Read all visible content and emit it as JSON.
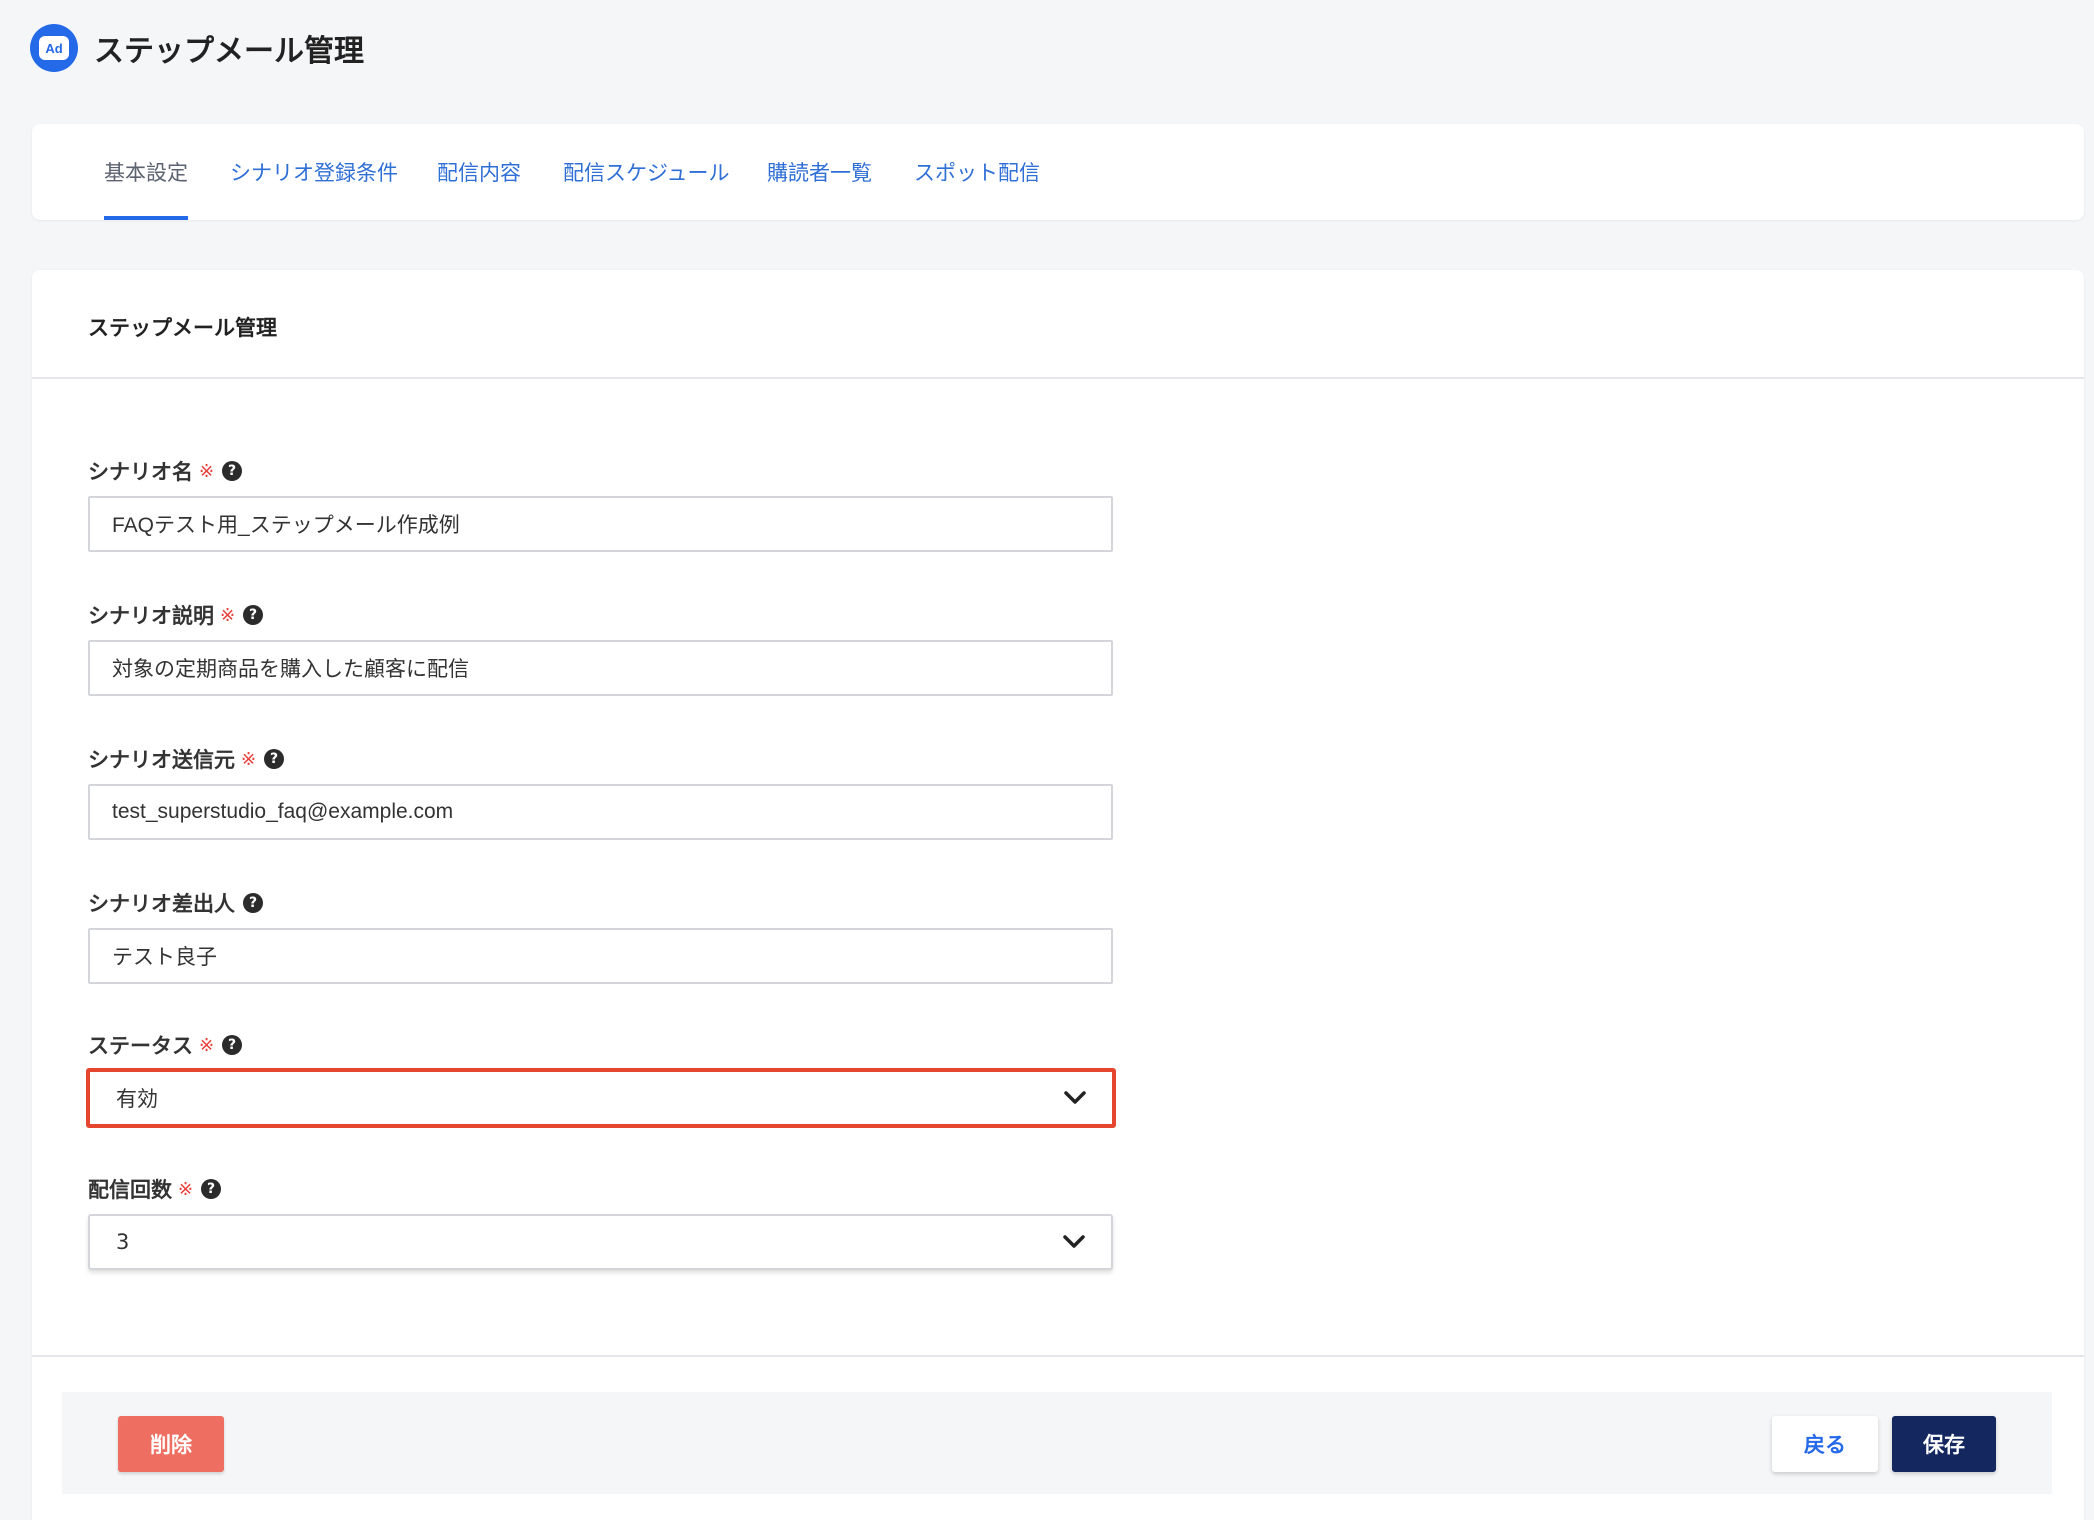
{
  "header": {
    "logo_text": "Ad",
    "title": "ステップメール管理"
  },
  "tabs": [
    {
      "label": "基本設定",
      "active": true
    },
    {
      "label": "シナリオ登録条件",
      "active": false
    },
    {
      "label": "配信内容",
      "active": false
    },
    {
      "label": "配信スケジュール",
      "active": false
    },
    {
      "label": "購読者一覧",
      "active": false
    },
    {
      "label": "スポット配信",
      "active": false
    }
  ],
  "card": {
    "title": "ステップメール管理"
  },
  "form": {
    "required_mark": "※",
    "help_glyph": "?",
    "scenario_name": {
      "label": "シナリオ名",
      "value": "FAQテスト用_ステップメール作成例"
    },
    "scenario_description": {
      "label": "シナリオ説明",
      "value": "対象の定期商品を購入した顧客に配信"
    },
    "scenario_sender": {
      "label": "シナリオ送信元",
      "value": "test_superstudio_faq@example.com"
    },
    "scenario_from_name": {
      "label": "シナリオ差出人",
      "value": "テスト良子"
    },
    "status": {
      "label": "ステータス",
      "value": "有効"
    },
    "delivery_count": {
      "label": "配信回数",
      "value": "3"
    }
  },
  "footer": {
    "delete_label": "削除",
    "back_label": "戻る",
    "save_label": "保存"
  },
  "colors": {
    "accent": "#2469e8",
    "highlight_border": "#e6452f",
    "delete_button": "#ee6e61",
    "save_button": "#14285f",
    "required": "#e8413b"
  }
}
